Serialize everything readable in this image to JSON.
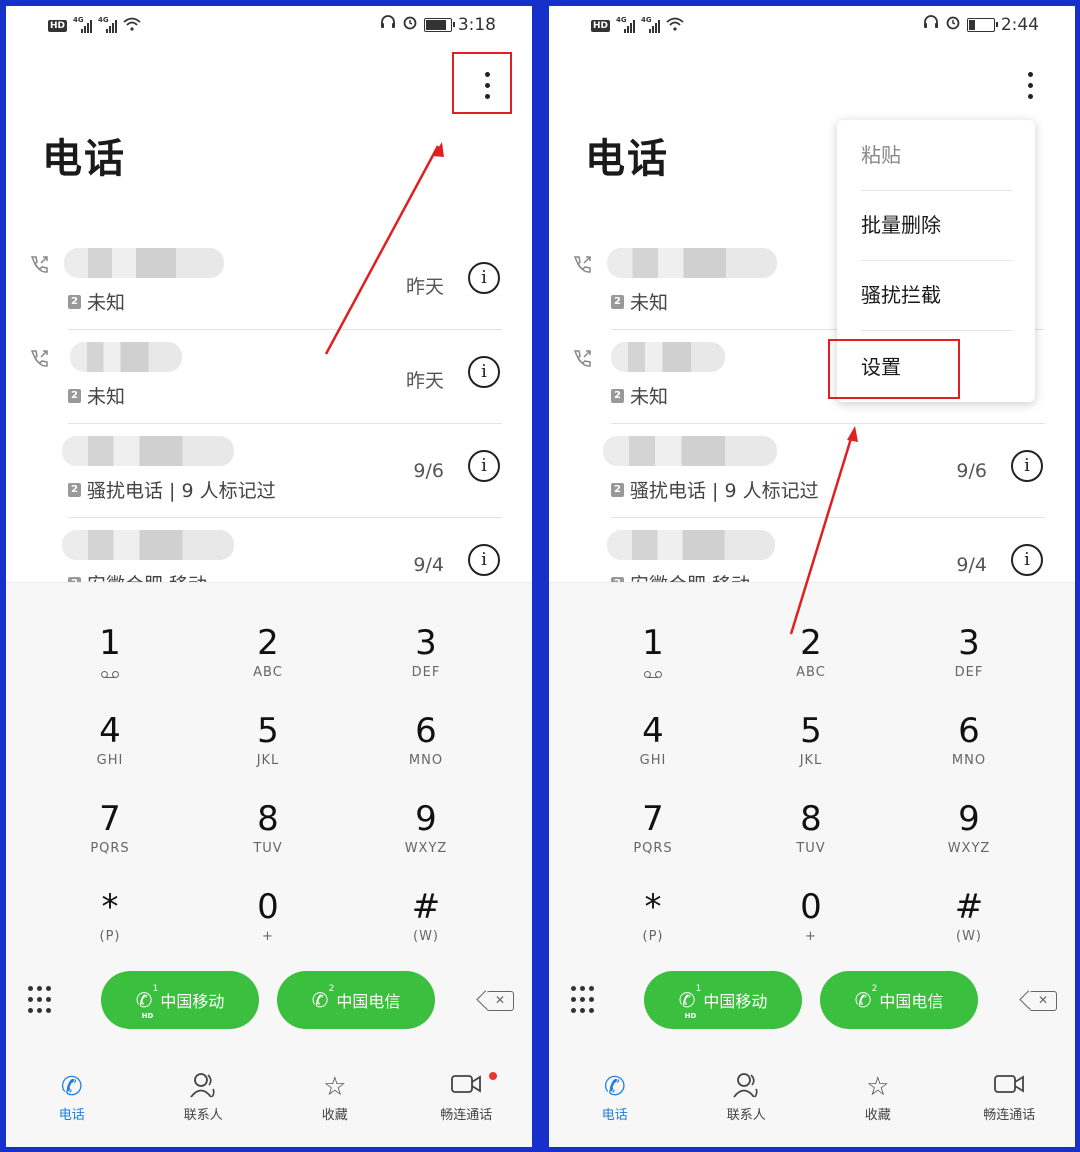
{
  "left": {
    "status": {
      "time": "3:18",
      "hd": "HD",
      "net": "4G"
    },
    "title": "电话",
    "calls": [
      {
        "sub": "未知",
        "date": "昨天"
      },
      {
        "sub": "未知",
        "date": "昨天"
      },
      {
        "sub": "骚扰电话 | 9 人标记过",
        "date": "9/6"
      },
      {
        "sub": "安徽合肥 移动",
        "date": "9/4"
      }
    ]
  },
  "right": {
    "status": {
      "time": "2:44",
      "hd": "HD",
      "net": "4G"
    },
    "title": "电话",
    "calls": [
      {
        "sub": "未知",
        "date": ""
      },
      {
        "sub": "未知",
        "date": ""
      },
      {
        "sub": "骚扰电话 | 9 人标记过",
        "date": "9/6"
      },
      {
        "sub": "安徽合肥 移动",
        "date": "9/4"
      }
    ],
    "menu": [
      "粘贴",
      "批量删除",
      "骚扰拦截",
      "设置"
    ]
  },
  "keypad": [
    {
      "d": "1",
      "l": ""
    },
    {
      "d": "2",
      "l": "ABC"
    },
    {
      "d": "3",
      "l": "DEF"
    },
    {
      "d": "4",
      "l": "GHI"
    },
    {
      "d": "5",
      "l": "JKL"
    },
    {
      "d": "6",
      "l": "MNO"
    },
    {
      "d": "7",
      "l": "PQRS"
    },
    {
      "d": "8",
      "l": "TUV"
    },
    {
      "d": "9",
      "l": "WXYZ"
    },
    {
      "d": "*",
      "l": "(P)"
    },
    {
      "d": "0",
      "l": "+"
    },
    {
      "d": "#",
      "l": "(W)"
    }
  ],
  "sim_buttons": [
    {
      "label": "中国移动",
      "sim": "1",
      "hd": "HD"
    },
    {
      "label": "中国电信",
      "sim": "2",
      "hd": ""
    }
  ],
  "nav": [
    "电话",
    "联系人",
    "收藏",
    "畅连通话"
  ],
  "sim_badge": "2",
  "info_glyph": "i",
  "colors": {
    "green": "#3bbf3f",
    "active": "#1e7ee0",
    "highlight": "#e02020",
    "frame": "#1630c9"
  }
}
